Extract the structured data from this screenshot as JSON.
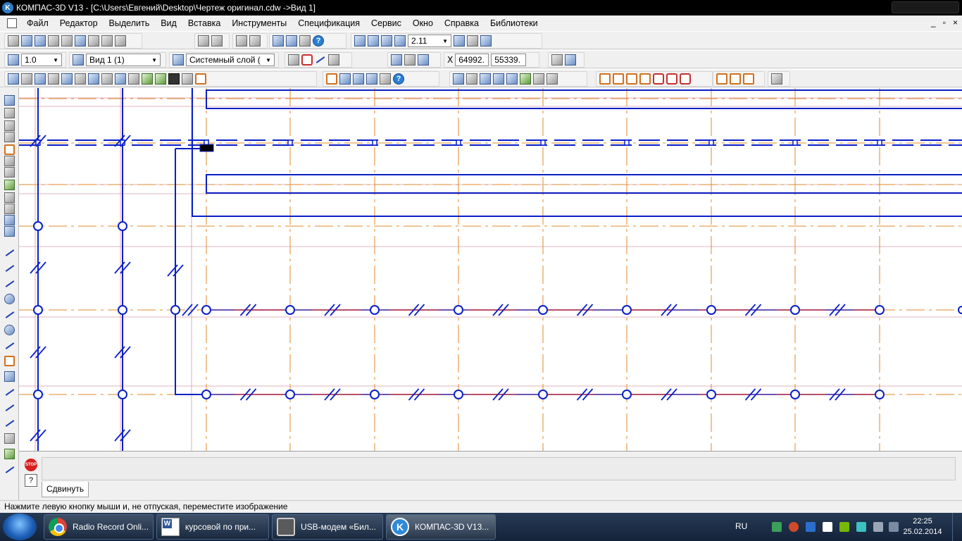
{
  "window": {
    "title": "КОМПАС-3D V13 - [C:\\Users\\Евгений\\Desktop\\Чертеж оригинал.cdw ->Вид 1]"
  },
  "menu": {
    "items": [
      "Файл",
      "Редактор",
      "Выделить",
      "Вид",
      "Вставка",
      "Инструменты",
      "Спецификация",
      "Сервис",
      "Окно",
      "Справка",
      "Библиотеки"
    ],
    "mdi_controls": [
      "_",
      "▫",
      "×"
    ]
  },
  "toolbar_standard": {
    "zoom_value": "2.11"
  },
  "toolbar_current_state": {
    "step_value": "1.0",
    "view_value": "Вид 1 (1)",
    "layer_value": "Системный слой (",
    "coord_x": "64992.",
    "coord_y": "55339."
  },
  "command_panel": {
    "tab_label": "Сдвинуть",
    "stop_label": "STOP",
    "help_label": "?"
  },
  "status_bar": {
    "message": "Нажмите левую кнопку мыши и, не отпуская, переместите изображение"
  },
  "taskbar": {
    "tasks": [
      {
        "label": "Radio Record Onli...",
        "icon": "chrome-icon"
      },
      {
        "label": "курсовой по при...",
        "icon": "word-icon"
      },
      {
        "label": "USB-модем «Бил...",
        "icon": "modem-icon"
      },
      {
        "label": "КОМПАС-3D V13...",
        "icon": "kompas-icon"
      }
    ],
    "language": "RU",
    "time": "22:25",
    "date": "25.02.2014"
  },
  "colors": {
    "geometry_blue": "#0a1fc8",
    "axis_orange": "#e08a2a",
    "guide_pink": "#d99aa6",
    "accent_red": "#a0143a"
  }
}
